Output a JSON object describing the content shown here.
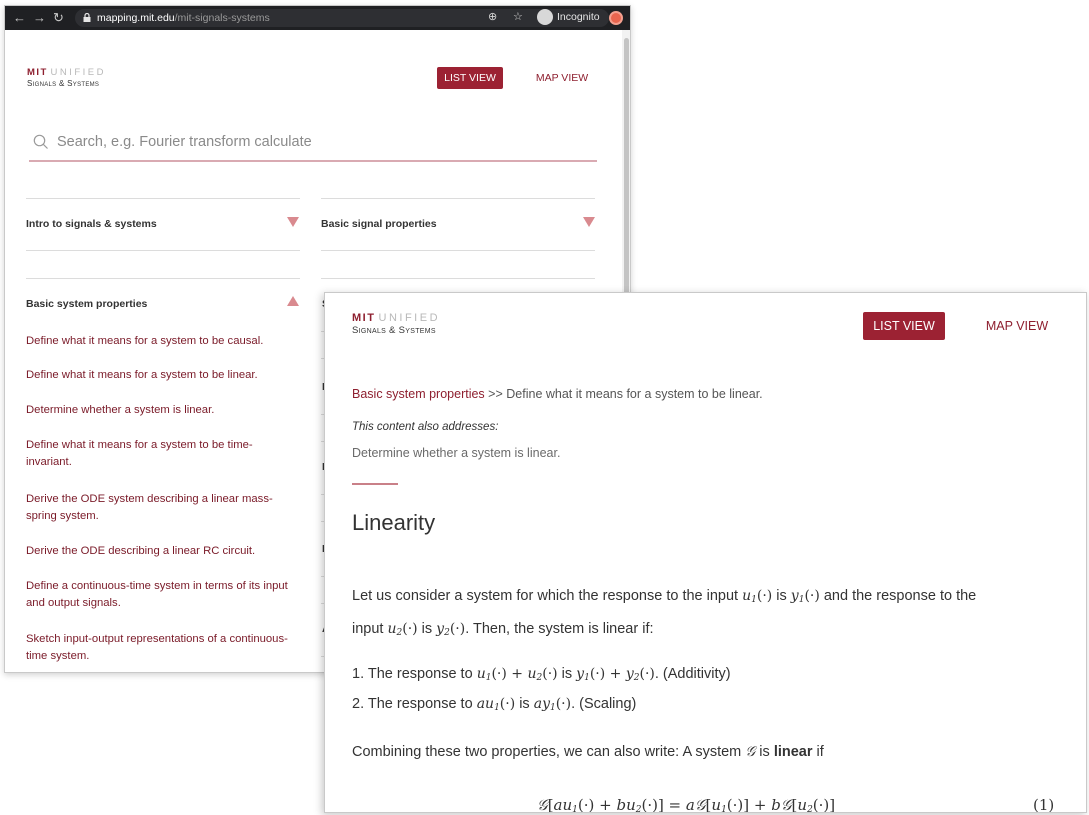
{
  "browser": {
    "url_host": "mapping.mit.edu",
    "url_path": "/mit-signals-systems",
    "mode_label": "Incognito"
  },
  "brand": {
    "line1_a": "MIT",
    "line1_b": "UNIFIED",
    "line2": "Signals & Systems"
  },
  "views": {
    "list_label": "LIST VIEW",
    "map_label": "MAP VIEW"
  },
  "search": {
    "placeholder": "Search, e.g. Fourier transform calculate"
  },
  "accordion": {
    "topics": [
      {
        "title": "Intro to signals & systems",
        "state": "collapsed"
      },
      {
        "title": "Basic signal properties",
        "state": "collapsed"
      },
      {
        "title": "Basic system properties",
        "state": "expanded"
      }
    ],
    "objectives": [
      "Define what it means for a system to be causal.",
      "Define what it means for a system to be linear.",
      "Determine whether a system is linear.",
      "Define what it means for a system to be time-invariant.",
      "Derive the ODE system describing a linear mass-spring system.",
      "Derive the ODE describing a linear RC circuit.",
      "Define a continuous-time system in terms of its input and output signals.",
      "Sketch input-output representations of a continuous-time system."
    ],
    "hidden_stubs": [
      "S",
      "P",
      "L",
      "L",
      "A"
    ]
  },
  "detail": {
    "breadcrumb_link": "Basic system properties",
    "breadcrumb_sep": ">>",
    "breadcrumb_current": "Define what it means for a system to be linear.",
    "also_label": "This content also addresses:",
    "also_item": "Determine whether a system is linear.",
    "heading": "Linearity",
    "p1_a": "Let us consider a system for which the response to the input",
    "p1_b": "is",
    "p1_c": "and the response to the",
    "p2_a": "input",
    "p2_b": "is",
    "p2_c": ". Then, the system is linear if:",
    "li1_a": "1. The response to",
    "li1_b": "is",
    "li1_c": ". (Additivity)",
    "li2_a": "2. The response to",
    "li2_b": "is",
    "li2_c": ". (Scaling)",
    "p3_a": "Combining these two properties, we can also write: A system",
    "p3_b": "is",
    "p3_bold": "linear",
    "p3_c": "if",
    "eq_number": "(1)"
  },
  "colors": {
    "accent": "#9c2233",
    "link": "#7a1a28",
    "triangle": "#d98a8f"
  }
}
